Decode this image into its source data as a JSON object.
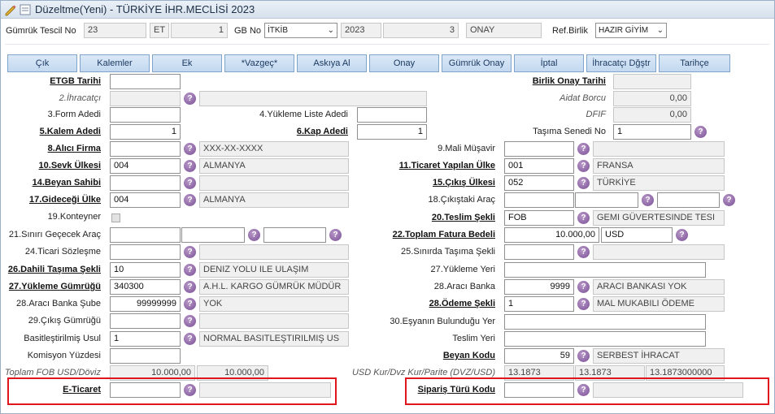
{
  "window": {
    "title": "Düzeltme(Yeni) - TÜRKİYE İHR.MECLİSİ 2023"
  },
  "header": {
    "gumruk_tescil_no_label": "Gümrük Tescil No",
    "tescil_no": "23",
    "tescil_code": "ET",
    "tescil_seq": "1",
    "gb_no_label": "GB No",
    "gb_select": "İTKİB",
    "gb_year": "2023",
    "gb_seq": "3",
    "gb_status": "ONAY",
    "ref_birlik_label": "Ref.Birlik",
    "ref_birlik_select": "HAZIR GİYİM"
  },
  "toolbar": {
    "buttons": [
      "Çık",
      "Kalemler",
      "Ek",
      "*Vazgeç*",
      "Askıya Al",
      "Onay",
      "Gümrük Onay",
      "İptal",
      "İhracatçı Dğştr",
      "Tarihçe"
    ]
  },
  "left": {
    "etgb_tarihi": {
      "label": "ETGB Tarihi",
      "value": ""
    },
    "ihracatci": {
      "label": "2.İhracatçı",
      "value": ""
    },
    "form_adedi": {
      "label": "3.Form Adedi",
      "value": ""
    },
    "kalem_adedi": {
      "label": "5.Kalem Adedi",
      "value": "1"
    },
    "alici_firma": {
      "label": "8.Alıcı Firma",
      "value": "",
      "desc": "XXX-XX-XXXX"
    },
    "sevk_ulkesi": {
      "label": "10.Sevk Ülkesi",
      "value": "004",
      "desc": "ALMANYA"
    },
    "beyan_sahibi": {
      "label": "14.Beyan Sahibi",
      "value": "",
      "desc": ""
    },
    "gidecegi_ulke": {
      "label": "17.Gideceği Ülke",
      "value": "004",
      "desc": "ALMANYA"
    },
    "konteyner": {
      "label": "19.Konteyner"
    },
    "siniri_gececek_arac": {
      "label": "21.Sınırı Geçecek Araç"
    },
    "ticari_sozlesme": {
      "label": "24.Ticari Sözleşme",
      "value": ""
    },
    "dahili_tasima": {
      "label": "26.Dahili Taşıma Şekli",
      "value": "10",
      "desc": "DENIZ YOLU ILE ULAŞIM"
    },
    "yukleme_gumrugu": {
      "label": "27.Yükleme Gümrüğü",
      "value": "340300",
      "desc": "A.H.L. KARGO GÜMRÜK MÜDÜR"
    },
    "araci_banka_sube": {
      "label": "28.Aracı Banka Şube",
      "value": "99999999",
      "desc": "YOK"
    },
    "cikis_gumrugu": {
      "label": "29.Çıkış Gümrüğü",
      "value": ""
    },
    "basitlestirilmis_usul": {
      "label": "Basitleştirilmiş Usul",
      "value": "1",
      "desc": "NORMAL BASITLEŞTIRILMIŞ US"
    },
    "komisyon_yuzdesi": {
      "label": "Komisyon Yüzdesi",
      "value": ""
    },
    "toplam_fob": {
      "label": "Toplam FOB USD/Döviz",
      "usd": "10.000,00",
      "doviz": "10.000,00"
    },
    "e_ticaret": {
      "label": "E-Ticaret",
      "value": ""
    }
  },
  "middle": {
    "yukleme_liste_adedi": {
      "label": "4.Yükleme Liste Adedi",
      "value": ""
    },
    "kap_adedi": {
      "label": "6.Kap Adedi",
      "value": "1"
    }
  },
  "right": {
    "birlik_onay_tarihi": {
      "label": "Birlik Onay Tarihi",
      "value": ""
    },
    "aidat_borcu": {
      "label": "Aidat Borcu",
      "value": "0,00"
    },
    "dfif": {
      "label": "DFIF",
      "value": "0,00"
    },
    "tasima_senedi_no": {
      "label": "Taşıma Senedi No",
      "value": "1"
    },
    "mali_musavir": {
      "label": "9.Mali Müşavir",
      "value": ""
    },
    "ticaret_yapilan_ulke": {
      "label": "11.Ticaret Yapılan Ülke",
      "value": "001",
      "desc": "FRANSA"
    },
    "cikis_ulkesi": {
      "label": "15.Çıkış Ülkesi",
      "value": "052",
      "desc": "TÜRKİYE"
    },
    "cikistaki_arac": {
      "label": "18.Çıkıştaki Araç"
    },
    "teslim_sekli": {
      "label": "20.Teslim Şekli",
      "value": "FOB",
      "desc": "GEMI GÜVERTESINDE TESI"
    },
    "toplam_fatura": {
      "label": "22.Toplam Fatura Bedeli",
      "value": "10.000,00",
      "currency": "USD"
    },
    "sinirda_tasima": {
      "label": "25.Sınırda Taşıma Şekli",
      "value": ""
    },
    "yukleme_yeri": {
      "label": "27.Yükleme Yeri",
      "value": ""
    },
    "araci_banka": {
      "label": "28.Aracı Banka",
      "value": "9999",
      "desc": "ARACI BANKASI YOK"
    },
    "odeme_sekli": {
      "label": "28.Ödeme Şekli",
      "value": "1",
      "desc": "MAL MUKABILI ÖDEME"
    },
    "esyanin_bulundugu_yer": {
      "label": "30.Eşyanın Bulunduğu Yer",
      "value": ""
    },
    "teslim_yeri": {
      "label": "Teslim Yeri",
      "value": ""
    },
    "beyan_kodu": {
      "label": "Beyan Kodu",
      "value": "59",
      "desc": "SERBEST İHRACAT"
    },
    "usd_kur": {
      "label": "USD Kur/Dvz Kur/Parite (DVZ/USD)",
      "usd": "13.1873",
      "dvz": "13.1873",
      "parite": "13.1873000000"
    },
    "siparis_turu_kodu": {
      "label": "Sipariş Türü Kodu",
      "value": ""
    }
  },
  "info_glyph": "?",
  "colors": {
    "highlight": "#e0161d",
    "info": "#7a4f96",
    "button": "#c3d8ef"
  }
}
